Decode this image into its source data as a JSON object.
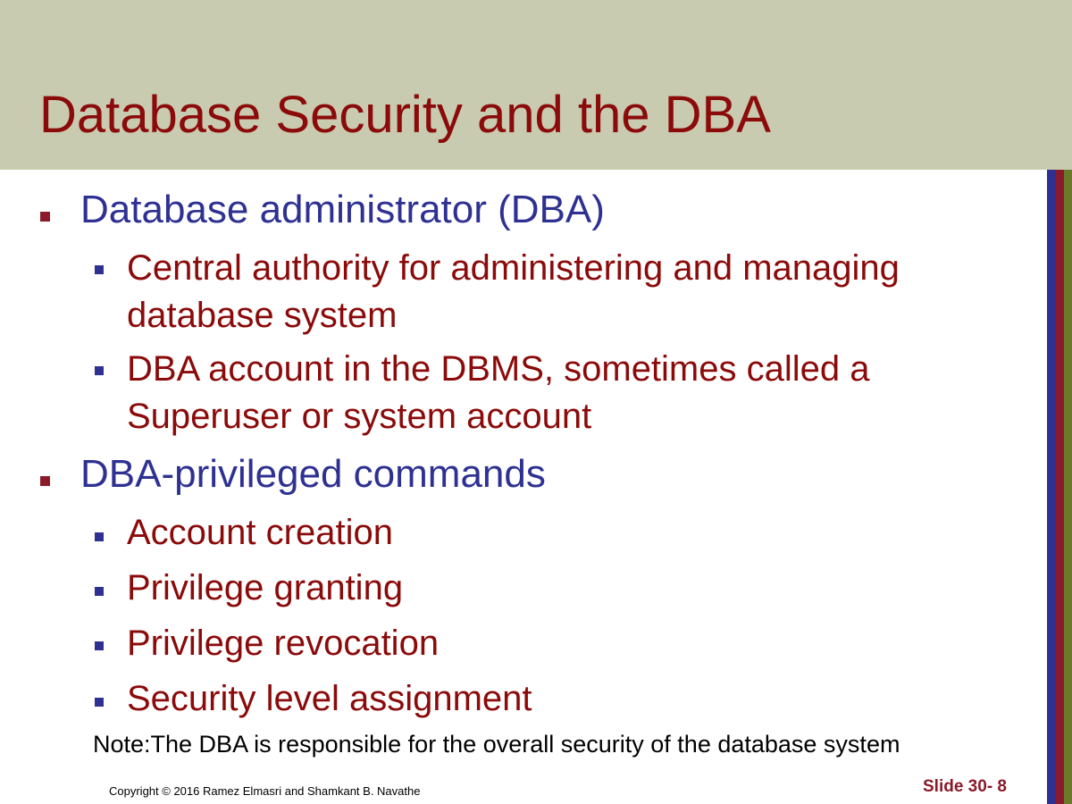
{
  "title": "Database Security and the DBA",
  "bullets": [
    {
      "text": "Database administrator (DBA)",
      "sub": [
        {
          "line1": "Central authority for administering and managing",
          "line2": "database system"
        },
        {
          "line1": "DBA account in the DBMS, sometimes called a",
          "line2": "Superuser or system account"
        }
      ]
    },
    {
      "text": "DBA-privileged commands",
      "sub": [
        {
          "line1": "Account creation"
        },
        {
          "line1": "Privilege granting"
        },
        {
          "line1": "Privilege revocation"
        },
        {
          "line1": "Security level assignment"
        }
      ]
    }
  ],
  "note": "Note:The DBA is responsible for the overall security of the database system",
  "footer": {
    "copyright": "Copyright © 2016 Ramez Elmasri and Shamkant B. Navathe",
    "slide_number": "Slide 30- 8"
  },
  "colors": {
    "header_bg": "#c9cbb0",
    "title": "#8b0a0a",
    "level1_text": "#2e3192",
    "level2_text": "#8b0a0a",
    "level1_bullet": "#8b1a2a",
    "level2_bullet": "#2e3192",
    "stripes": [
      "#2e3192",
      "#8b1a2a",
      "#6b7a2a"
    ]
  }
}
